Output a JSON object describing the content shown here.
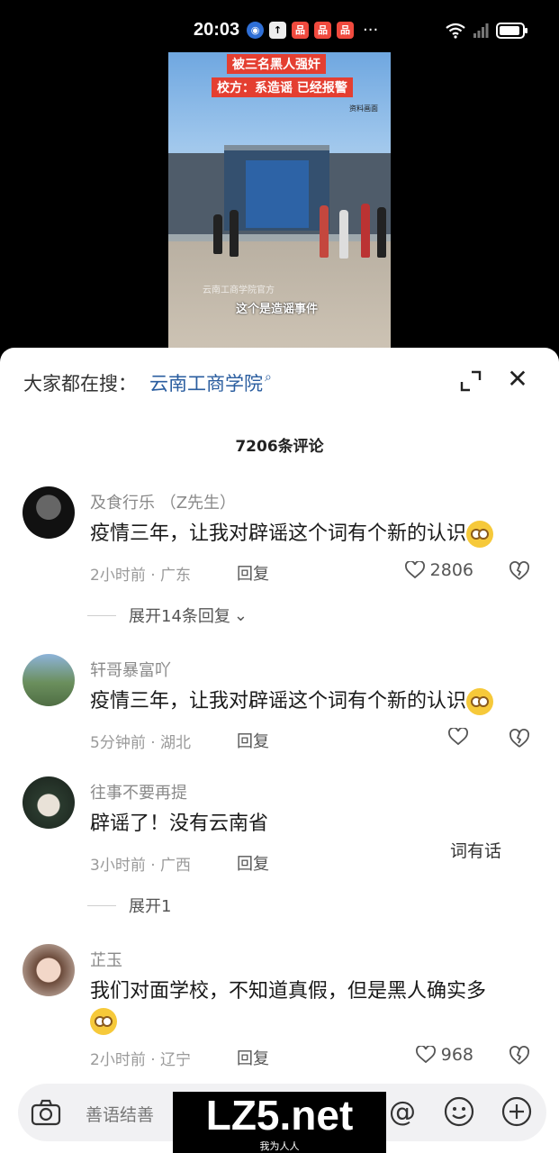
{
  "status_bar": {
    "time": "20:03",
    "more": "···"
  },
  "video": {
    "caption_line1": "被三名黑人强奸",
    "caption_line2": "校方：系造谣 已经报警",
    "tag": "资料画面",
    "subtitle": "这个是造谣事件",
    "watermark": "云南工商学院官方"
  },
  "search": {
    "prefix": "大家都在搜：",
    "term": "云南工商学院"
  },
  "comment_count": "7206条评论",
  "comments": [
    {
      "name": "及食行乐 （Z先生）",
      "text": "疫情三年，让我对辟谣这个词有个新的认识",
      "meta": "2小时前 · 广东",
      "reply": "回复",
      "likes": "2806",
      "expand": "展开14条回复"
    },
    {
      "name": "轩哥暴富吖",
      "text": "疫情三年，让我对辟谣这个词有个新的认识",
      "meta": "5分钟前 · 湖北",
      "reply": "回复",
      "likes": ""
    },
    {
      "name": "往事不要再提",
      "text": "辟谣了！没有云南省",
      "meta": "3小时前 · 广西",
      "reply": "回复",
      "overlay": "词有话",
      "expand": "展开1"
    },
    {
      "name": "芷玉",
      "text": "我们对面学校，不知道真假，但是黑人确实多",
      "meta": "2小时前 · 辽宁",
      "reply": "回复",
      "likes": "968"
    }
  ],
  "input": {
    "placeholder": "善语结善"
  },
  "watermark": {
    "text": "LZ5.net",
    "sub": "我为人人"
  },
  "colors": {
    "link": "#2a5d9f",
    "caption_bg": "#e43f31"
  }
}
